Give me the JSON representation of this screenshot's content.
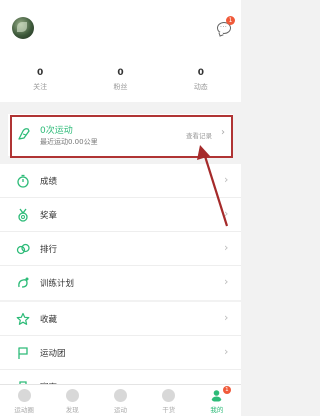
{
  "profile": {
    "message_badge": "1"
  },
  "stats": [
    {
      "num": "0",
      "label": "关注"
    },
    {
      "num": "0",
      "label": "粉丝"
    },
    {
      "num": "0",
      "label": "动态"
    }
  ],
  "activity": {
    "title": "0次运动",
    "subtitle": "最近运动0.00公里",
    "link": "查看记录",
    "chevron": "›",
    "accent_color": "#2dbb78",
    "highlight_color": "#b03434"
  },
  "menu_group_1": [
    {
      "label": "成绩",
      "icon": "stopwatch-icon"
    },
    {
      "label": "奖章",
      "icon": "medal-icon"
    },
    {
      "label": "排行",
      "icon": "ranking-icon"
    },
    {
      "label": "训练计划",
      "icon": "plan-icon"
    }
  ],
  "menu_group_2": [
    {
      "label": "收藏",
      "icon": "star-icon"
    },
    {
      "label": "运动团",
      "icon": "flag-icon"
    },
    {
      "label": "赛事",
      "icon": "trophy-icon"
    }
  ],
  "tabbar": {
    "tabs": [
      {
        "label": "运动圈"
      },
      {
        "label": "发现"
      },
      {
        "label": "运动"
      },
      {
        "label": "干货"
      },
      {
        "label": "我的"
      }
    ],
    "active_badge": "1"
  }
}
